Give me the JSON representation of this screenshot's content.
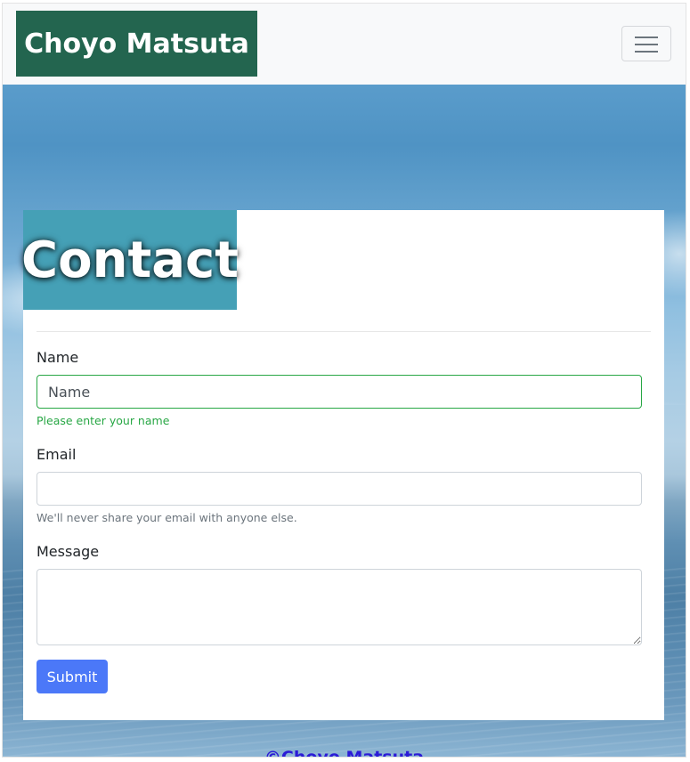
{
  "navbar": {
    "brand": "Choyo Matsuta",
    "toggler_icon": "hamburger-menu-icon"
  },
  "contact": {
    "title": "Contact",
    "name_label": "Name",
    "name_placeholder": "Name",
    "name_feedback": "Please enter your name",
    "email_label": "Email",
    "email_value": "",
    "email_help": "We'll never share your email with anyone else.",
    "message_label": "Message",
    "message_value": "",
    "submit_label": "Submit"
  },
  "footer": {
    "text": "©Choyo Matsuta"
  },
  "colors": {
    "brand_bg": "#23654f",
    "title_bg": "#45a0b6",
    "submit_bg": "#4b78f8",
    "valid_green": "#28a745",
    "footer_text": "#2b1bd6"
  }
}
